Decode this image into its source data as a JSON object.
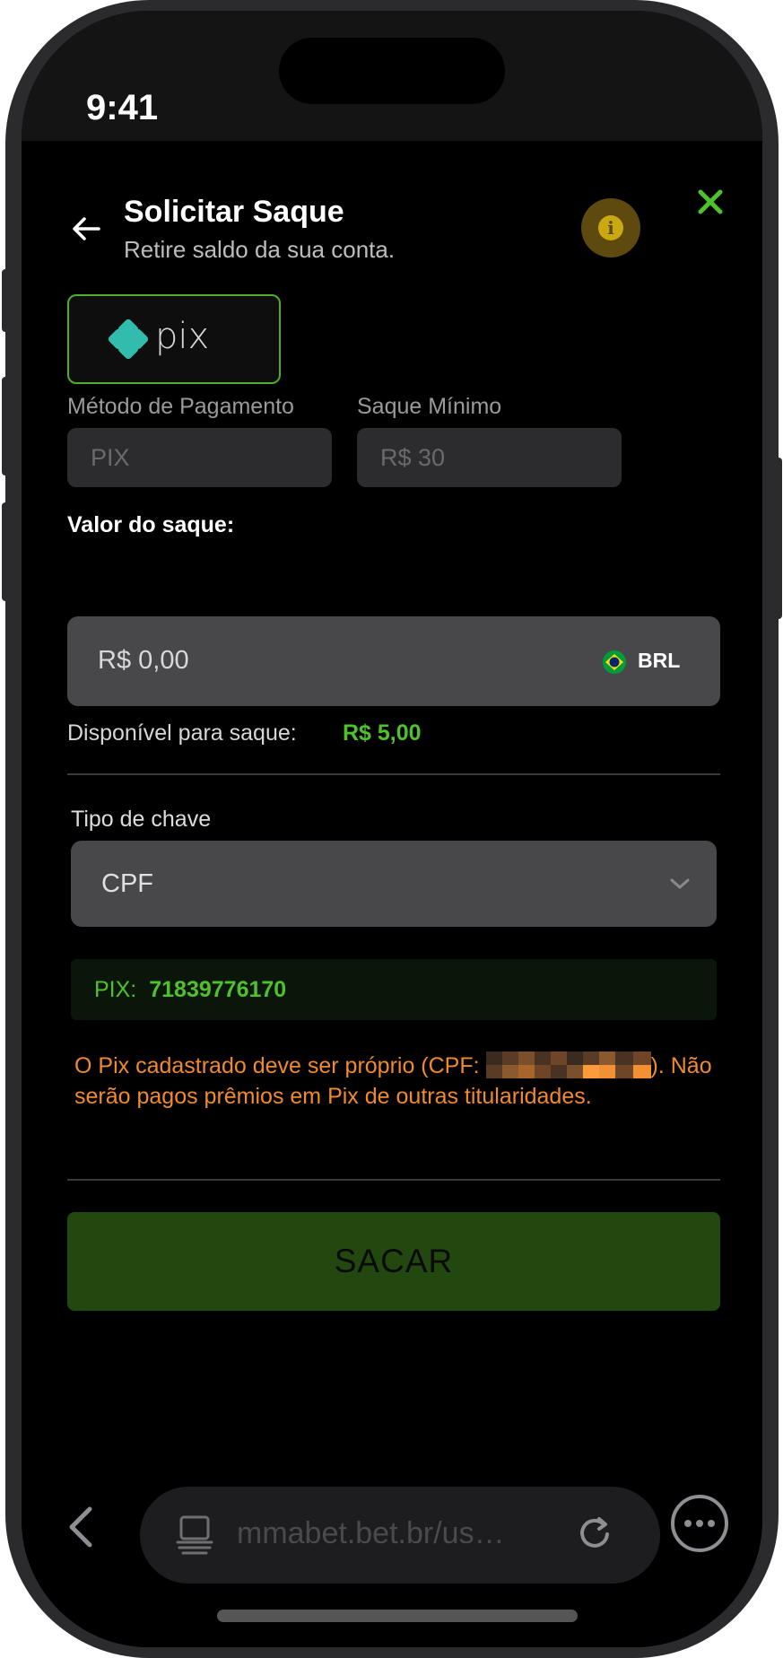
{
  "status_bar": {
    "time": "9:41"
  },
  "header": {
    "title": "Solicitar Saque",
    "subtitle": "Retire saldo da sua conta.",
    "info_symbol": "i"
  },
  "payment_method_logo": {
    "text": "pix"
  },
  "fields": {
    "payment_method": {
      "label": "Método de Pagamento",
      "value": "PIX"
    },
    "min_withdrawal": {
      "label": "Saque Mínimo",
      "value": "R$ 30"
    }
  },
  "amount": {
    "label": "Valor do saque:",
    "value": "R$ 0,00",
    "currency": "BRL"
  },
  "available": {
    "label": "Disponível para saque:",
    "value": "R$ 5,00"
  },
  "key_type": {
    "label": "Tipo de chave",
    "selected": "CPF"
  },
  "pix_key": {
    "label": "PIX:",
    "value": "71839776170"
  },
  "warning": {
    "before": "O Pix cadastrado deve ser próprio (CPF: ",
    "after": "). Não serão pagos prêmios em Pix de outras titularidades."
  },
  "submit": {
    "label": "SACAR"
  },
  "browser": {
    "url": "mmabet.bet.br/us…"
  },
  "colors": {
    "accent_green": "#4fc22b",
    "button_green": "#22480f",
    "warning_orange": "#f08a2c",
    "info_gold": "#c9a812"
  },
  "icons": [
    "back-arrow-icon",
    "info-icon",
    "close-icon",
    "pix-logo-icon",
    "brazil-flag-icon",
    "chevron-down-icon",
    "browser-back-icon",
    "tabs-icon",
    "reload-icon",
    "more-icon"
  ]
}
